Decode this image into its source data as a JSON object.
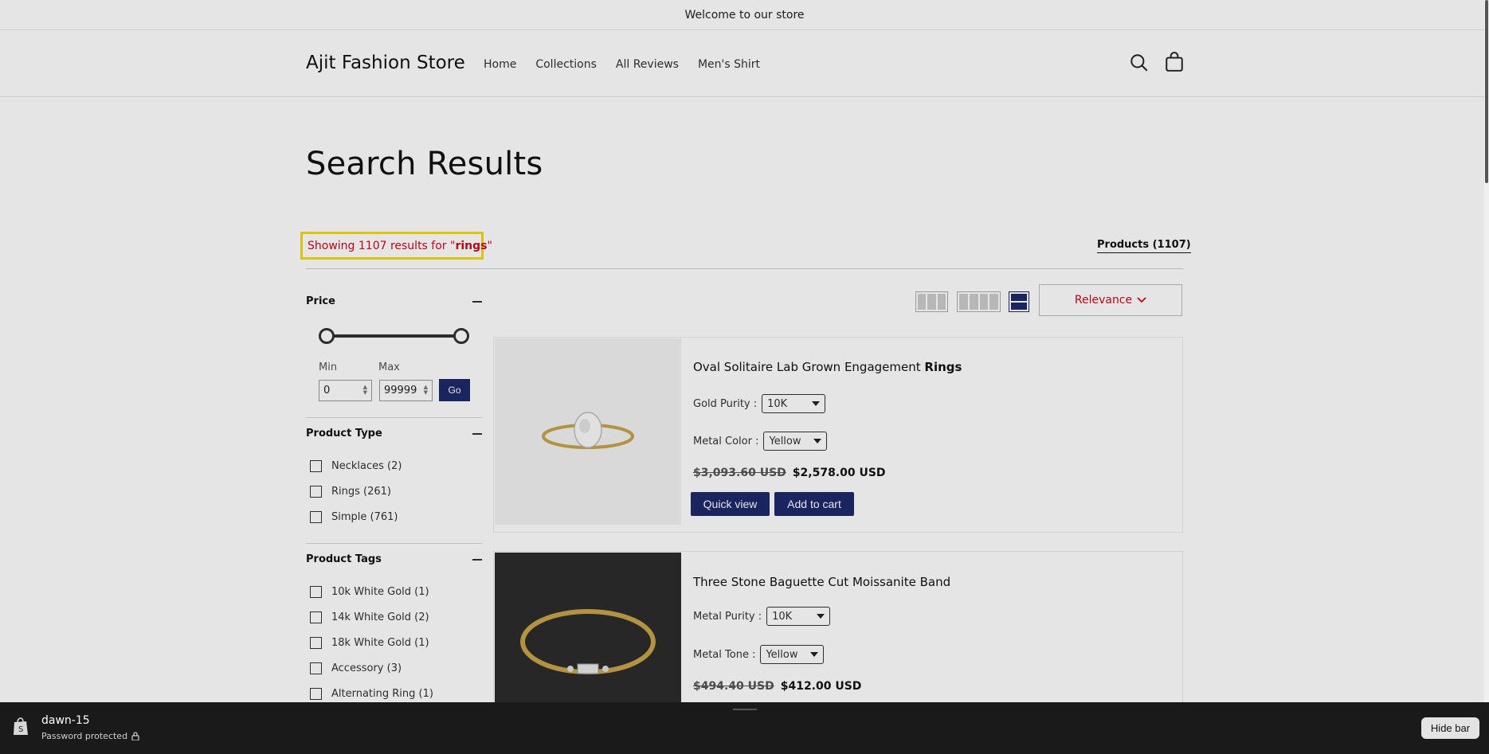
{
  "announcement": "Welcome to our store",
  "header": {
    "logo": "Ajit Fashion Store",
    "nav": [
      "Home",
      "Collections",
      "All Reviews",
      "Men's Shirt"
    ],
    "search_icon": "search-icon",
    "cart_icon": "cart-icon"
  },
  "page_title": "Search Results",
  "results": {
    "prefix": "Showing 1107 results for \"",
    "query": "rings",
    "suffix": "\"",
    "products_tab": "Products (1107)"
  },
  "filters": {
    "price": {
      "heading": "Price",
      "min_label": "Min",
      "max_label": "Max",
      "min_value": "0",
      "max_value": "99999",
      "go_label": "Go"
    },
    "product_type": {
      "heading": "Product Type",
      "items": [
        "Necklaces (2)",
        "Rings (261)",
        "Simple (761)"
      ]
    },
    "product_tags": {
      "heading": "Product Tags",
      "items": [
        "10k White Gold (1)",
        "14k White Gold (2)",
        "18k White Gold (1)",
        "Accessory (3)",
        "Alternating Ring (1)"
      ]
    }
  },
  "toolbar": {
    "sort_label": "Relevance"
  },
  "products": [
    {
      "title_plain": "Oval Solitaire Lab Grown Engagement ",
      "title_bold": "Rings",
      "option1_label": "Gold Purity :",
      "option1_value": "10K",
      "option2_label": "Metal Color :",
      "option2_value": "Yellow",
      "compare_price": "$3,093.60 USD",
      "price": "$2,578.00 USD",
      "quick_view": "Quick view",
      "add_to_cart": "Add to cart"
    },
    {
      "title_plain": "Three Stone Baguette Cut Moissanite Band",
      "title_bold": "",
      "option1_label": "Metal Purity :",
      "option1_value": "10K",
      "option2_label": "Metal Tone :",
      "option2_value": "Yellow",
      "compare_price": "$494.40 USD",
      "price": "$412.00 USD"
    }
  ],
  "admin_bar": {
    "store_name": "dawn-15",
    "status": "Password protected",
    "hide_label": "Hide bar"
  },
  "colors": {
    "accent_blue": "#1e2a6b",
    "highlight_red": "#d0021b",
    "highlight_border": "#f5d90a"
  }
}
